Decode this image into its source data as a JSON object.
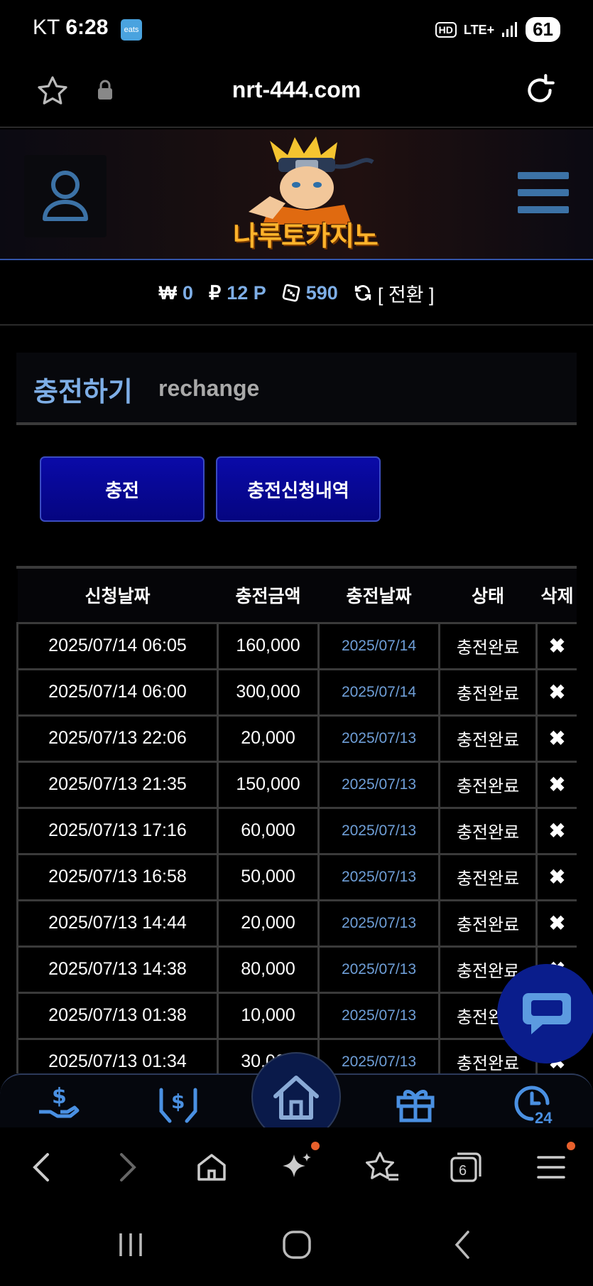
{
  "status_bar": {
    "carrier": "KT",
    "time": "6:28",
    "app_badge": "eats",
    "hd_label": "HD",
    "network": "LTE+",
    "battery": "61"
  },
  "browser": {
    "url": "nrt-444.com"
  },
  "site": {
    "logo_text": "나루토카지노"
  },
  "balance": {
    "won_symbol": "₩",
    "won_value": "0",
    "point_symbol": "₽",
    "point_value": "12 P",
    "chip_value": "590",
    "switch_label": "[ 전환 ]"
  },
  "section": {
    "title_ko": "충전하기",
    "title_en": "rechange"
  },
  "tabs": {
    "charge": "충전",
    "history": "충전신청내역"
  },
  "table": {
    "headers": [
      "신청날짜",
      "충전금액",
      "충전날짜",
      "상태",
      "삭제"
    ],
    "rows": [
      {
        "request_date": "2025/07/14 06:05",
        "amount": "160,000",
        "charge_date": "2025/07/14",
        "status": "충전완료",
        "delete": "✖"
      },
      {
        "request_date": "2025/07/14 06:00",
        "amount": "300,000",
        "charge_date": "2025/07/14",
        "status": "충전완료",
        "delete": "✖"
      },
      {
        "request_date": "2025/07/13 22:06",
        "amount": "20,000",
        "charge_date": "2025/07/13",
        "status": "충전완료",
        "delete": "✖"
      },
      {
        "request_date": "2025/07/13 21:35",
        "amount": "150,000",
        "charge_date": "2025/07/13",
        "status": "충전완료",
        "delete": "✖"
      },
      {
        "request_date": "2025/07/13 17:16",
        "amount": "60,000",
        "charge_date": "2025/07/13",
        "status": "충전완료",
        "delete": "✖"
      },
      {
        "request_date": "2025/07/13 16:58",
        "amount": "50,000",
        "charge_date": "2025/07/13",
        "status": "충전완료",
        "delete": "✖"
      },
      {
        "request_date": "2025/07/13 14:44",
        "amount": "20,000",
        "charge_date": "2025/07/13",
        "status": "충전완료",
        "delete": "✖"
      },
      {
        "request_date": "2025/07/13 14:38",
        "amount": "80,000",
        "charge_date": "2025/07/13",
        "status": "충전완료",
        "delete": "✖"
      },
      {
        "request_date": "2025/07/13 01:38",
        "amount": "10,000",
        "charge_date": "2025/07/13",
        "status": "충전완료",
        "delete": "✖"
      },
      {
        "request_date": "2025/07/13 01:34",
        "amount": "30,000",
        "charge_date": "2025/07/13",
        "status": "충전완료",
        "delete": "✖"
      }
    ]
  },
  "bottom_nav": {
    "badge_24": "24"
  },
  "browser_toolbar": {
    "tab_count": "6"
  },
  "colors": {
    "accent_blue": "#7eaee6",
    "button_blue": "#0a0aa8",
    "notification_orange": "#e8602c"
  }
}
